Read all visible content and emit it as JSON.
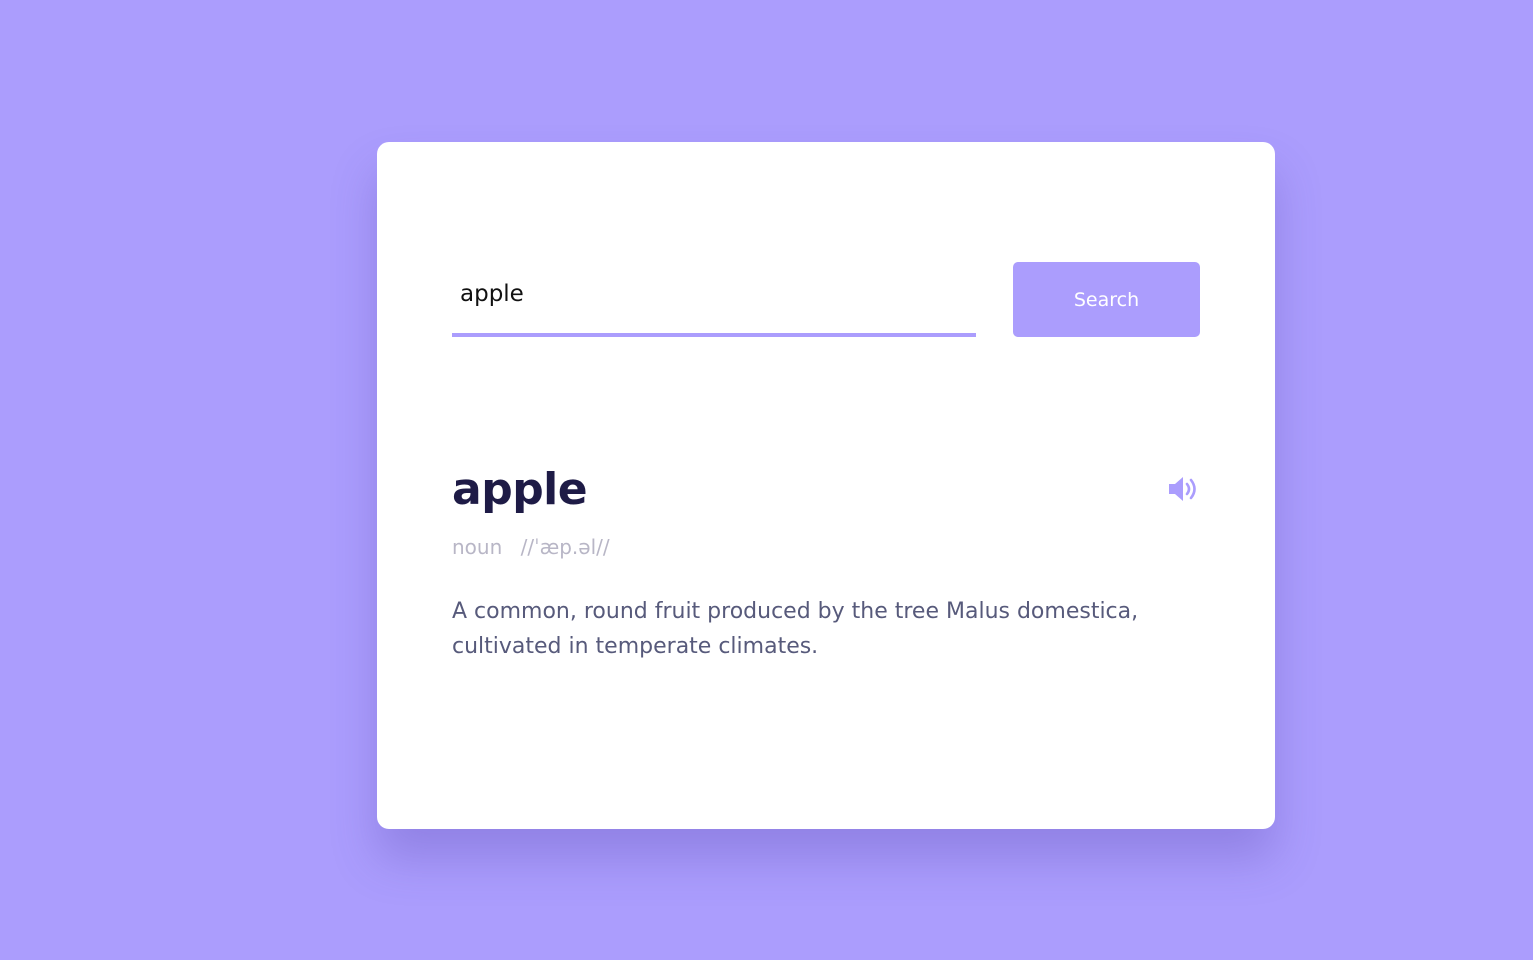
{
  "search": {
    "value": "apple",
    "button_label": "Search"
  },
  "result": {
    "word": "apple",
    "part_of_speech": "noun",
    "phonetic": "//ˈæp.əl//",
    "meaning": "A common, round fruit produced by the tree Malus domestica, cultivated in temperate climates.",
    "sound_icon": "volume-icon"
  },
  "colors": {
    "background": "#ab9dfd",
    "accent": "#ab9dfd",
    "word": "#1e1b46",
    "meta": "#b8b6c6",
    "meaning": "#575a7b"
  }
}
